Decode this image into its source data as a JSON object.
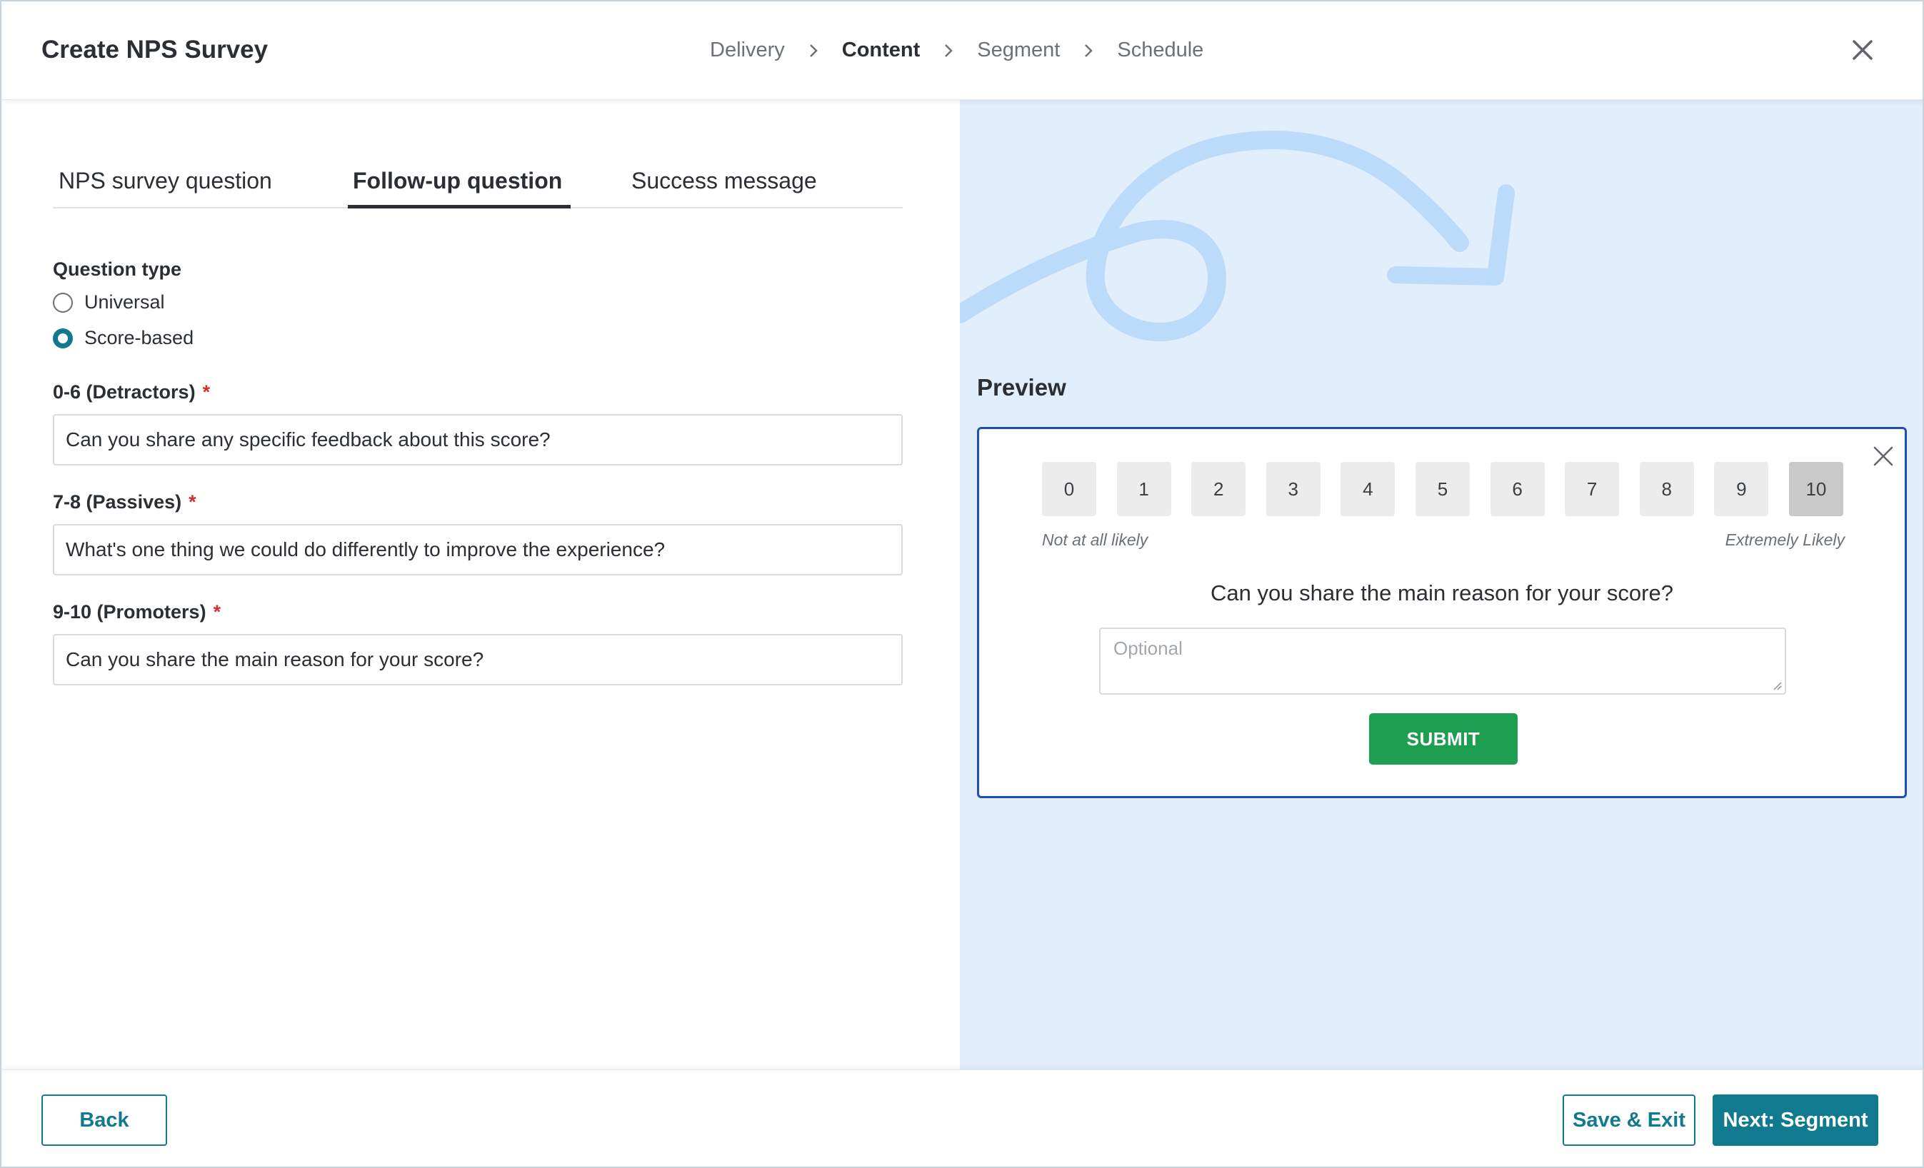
{
  "header": {
    "title": "Create NPS Survey",
    "steps": [
      {
        "label": "Delivery",
        "active": false
      },
      {
        "label": "Content",
        "active": true
      },
      {
        "label": "Segment",
        "active": false
      },
      {
        "label": "Schedule",
        "active": false
      }
    ],
    "close_icon": "close-icon",
    "separator_icon": "chevron-right-icon"
  },
  "tabs": [
    {
      "label": "NPS survey question",
      "active": false
    },
    {
      "label": "Follow-up question",
      "active": true
    },
    {
      "label": "Success message",
      "active": false
    }
  ],
  "form": {
    "question_type_label": "Question type",
    "options": [
      {
        "label": "Universal",
        "checked": false
      },
      {
        "label": "Score-based",
        "checked": true
      }
    ],
    "required_marker": "*",
    "fields": [
      {
        "label": "0-6 (Detractors)",
        "value": "Can you share any specific feedback about this score?"
      },
      {
        "label": "7-8 (Passives)",
        "value": "What's one thing we could do differently to improve the experience?"
      },
      {
        "label": "9-10 (Promoters)",
        "value": "Can you share the main reason for your score?"
      }
    ]
  },
  "preview": {
    "title": "Preview",
    "scores": [
      "0",
      "1",
      "2",
      "3",
      "4",
      "5",
      "6",
      "7",
      "8",
      "9",
      "10"
    ],
    "selected_score": "10",
    "low_label": "Not at all likely",
    "high_label": "Extremely Likely",
    "question": "Can you share the main reason for your score?",
    "textarea_placeholder": "Optional",
    "submit_label": "SUBMIT"
  },
  "footer": {
    "back_label": "Back",
    "save_exit_label": "Save & Exit",
    "next_label": "Next: Segment"
  },
  "colors": {
    "accent": "#127a8f",
    "submit": "#1e9e50",
    "preview_border": "#1f4fb6",
    "preview_bg": "#e1eefb",
    "required": "#d32f2f"
  }
}
